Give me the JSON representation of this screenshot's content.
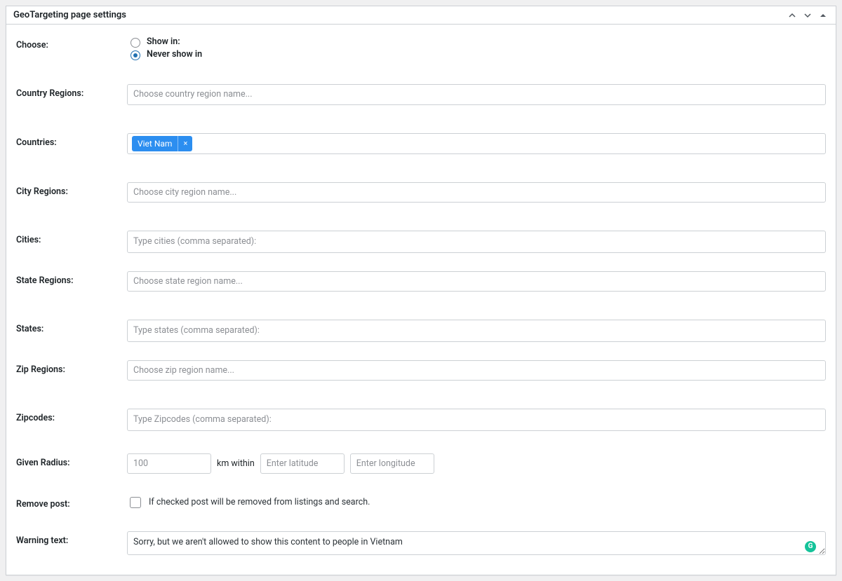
{
  "panel": {
    "title": "GeoTargeting page settings"
  },
  "labels": {
    "choose": "Choose:",
    "country_regions": "Country Regions:",
    "countries": "Countries:",
    "city_regions": "City Regions:",
    "cities": "Cities:",
    "state_regions": "State Regions:",
    "states": "States:",
    "zip_regions": "Zip Regions:",
    "zipcodes": "Zipcodes:",
    "given_radius": "Given Radius:",
    "remove_post": "Remove post:",
    "warning_text": "Warning text:"
  },
  "choose": {
    "show_in": "Show in:",
    "never_show_in": "Never show in",
    "selected": "never_show_in"
  },
  "placeholders": {
    "country_regions": "Choose country region name...",
    "city_regions": "Choose city region name...",
    "cities": "Type cities (comma separated):",
    "state_regions": "Choose state region name...",
    "states": "Type states (comma separated):",
    "zip_regions": "Choose zip region name...",
    "zipcodes": "Type Zipcodes (comma separated):",
    "radius_value": "100",
    "latitude": "Enter latitude",
    "longitude": "Enter longitude"
  },
  "countries": {
    "tags": [
      "Viet Nam"
    ],
    "remove_glyph": "×"
  },
  "radius": {
    "value": "100",
    "unit_label": "km within"
  },
  "remove_post": {
    "checked": false,
    "description": "If checked post will be removed from listings and search."
  },
  "warning_text": {
    "value": "Sorry, but we aren't allowed to show this content to people in Vietnam"
  },
  "icons": {
    "grammarly": "G"
  }
}
